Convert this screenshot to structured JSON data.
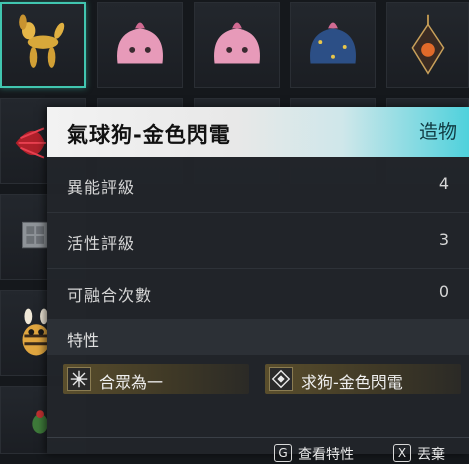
{
  "item": {
    "name": "氣球狗-金色閃電",
    "category": "造物"
  },
  "stats": [
    {
      "label": "異能評級",
      "value": "4"
    },
    {
      "label": "活性評級",
      "value": "3"
    },
    {
      "label": "可融合次數",
      "value": "0"
    }
  ],
  "traits": {
    "header": "特性",
    "items": [
      {
        "label": "合眾為一",
        "icon": "snowflake-star-icon"
      },
      {
        "label": "求狗-金色閃電",
        "icon": "diamond-icon"
      }
    ]
  },
  "footer": {
    "view_key": "G",
    "view_label": "查看特性",
    "drop_key": "X",
    "drop_label": "丟棄"
  },
  "colors": {
    "selection": "#41c6b0",
    "title_accent": "#4fd1dc",
    "trait_gold": "#5a4e2c"
  },
  "inventory_icons": [
    "balloon-dog-icon",
    "pink-blob-icon",
    "pink-blob-icon",
    "blue-blob-icon",
    "lantern-icon",
    "red-feather-icon",
    "metal-cube-icon",
    "bee-creature-icon",
    "green-creature-icon"
  ]
}
